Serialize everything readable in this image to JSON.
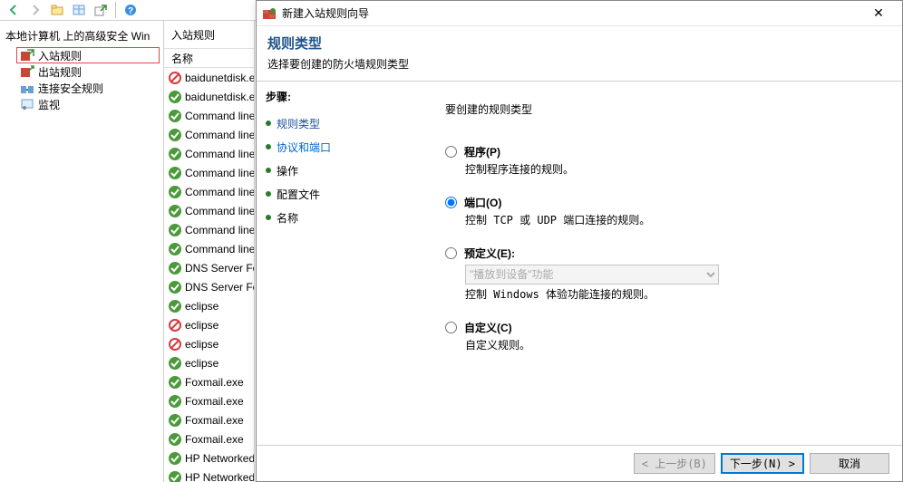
{
  "toolbar": {
    "icons": [
      "back",
      "forward",
      "folder",
      "grid",
      "export",
      "help",
      "spacer"
    ]
  },
  "tree": {
    "title": "本地计算机 上的高级安全 Win",
    "items": [
      {
        "label": "入站规则",
        "icon": "inbound",
        "selected": true
      },
      {
        "label": "出站规则",
        "icon": "outbound"
      },
      {
        "label": "连接安全规则",
        "icon": "connsec"
      },
      {
        "label": "监视",
        "icon": "monitor"
      }
    ]
  },
  "list": {
    "panel_title": "入站规则",
    "column_header": "名称",
    "rows": [
      {
        "name": "baidunetdisk.e",
        "status": "block"
      },
      {
        "name": "baidunetdisk.e",
        "status": "allow"
      },
      {
        "name": "Command line",
        "status": "allow"
      },
      {
        "name": "Command line",
        "status": "allow"
      },
      {
        "name": "Command line",
        "status": "allow"
      },
      {
        "name": "Command line",
        "status": "allow"
      },
      {
        "name": "Command line",
        "status": "allow"
      },
      {
        "name": "Command line",
        "status": "allow"
      },
      {
        "name": "Command line",
        "status": "allow"
      },
      {
        "name": "Command line",
        "status": "allow"
      },
      {
        "name": "DNS Server Fo",
        "status": "allow"
      },
      {
        "name": "DNS Server Fo",
        "status": "allow"
      },
      {
        "name": "eclipse",
        "status": "allow"
      },
      {
        "name": "eclipse",
        "status": "block"
      },
      {
        "name": "eclipse",
        "status": "block"
      },
      {
        "name": "eclipse",
        "status": "allow"
      },
      {
        "name": "Foxmail.exe",
        "status": "allow"
      },
      {
        "name": "Foxmail.exe",
        "status": "allow"
      },
      {
        "name": "Foxmail.exe",
        "status": "allow"
      },
      {
        "name": "Foxmail.exe",
        "status": "allow"
      },
      {
        "name": "HP Networked",
        "status": "allow"
      },
      {
        "name": "HP Networked",
        "status": "allow"
      }
    ]
  },
  "wizard": {
    "title": "新建入站规则向导",
    "header_title": "规则类型",
    "header_sub": "选择要创建的防火墙规则类型",
    "steps_title": "步骤:",
    "steps": [
      {
        "label": "规则类型",
        "state": "current"
      },
      {
        "label": "协议和端口",
        "state": "link"
      },
      {
        "label": "操作",
        "state": ""
      },
      {
        "label": "配置文件",
        "state": ""
      },
      {
        "label": "名称",
        "state": ""
      }
    ],
    "content_title": "要创建的规则类型",
    "options": [
      {
        "key": "program",
        "label": "程序(P)",
        "desc": "控制程序连接的规则。",
        "selected": false
      },
      {
        "key": "port",
        "label": "端口(O)",
        "desc": "控制 TCP 或 UDP 端口连接的规则。",
        "selected": true
      },
      {
        "key": "predefined",
        "label": "预定义(E):",
        "desc": "控制 Windows 体验功能连接的规则。",
        "selected": false,
        "dropdown": "\"播放到设备\"功能"
      },
      {
        "key": "custom",
        "label": "自定义(C)",
        "desc": "自定义规则。",
        "selected": false
      }
    ],
    "buttons": {
      "back": "< 上一步(B)",
      "next": "下一步(N) >",
      "cancel": "取消"
    }
  }
}
